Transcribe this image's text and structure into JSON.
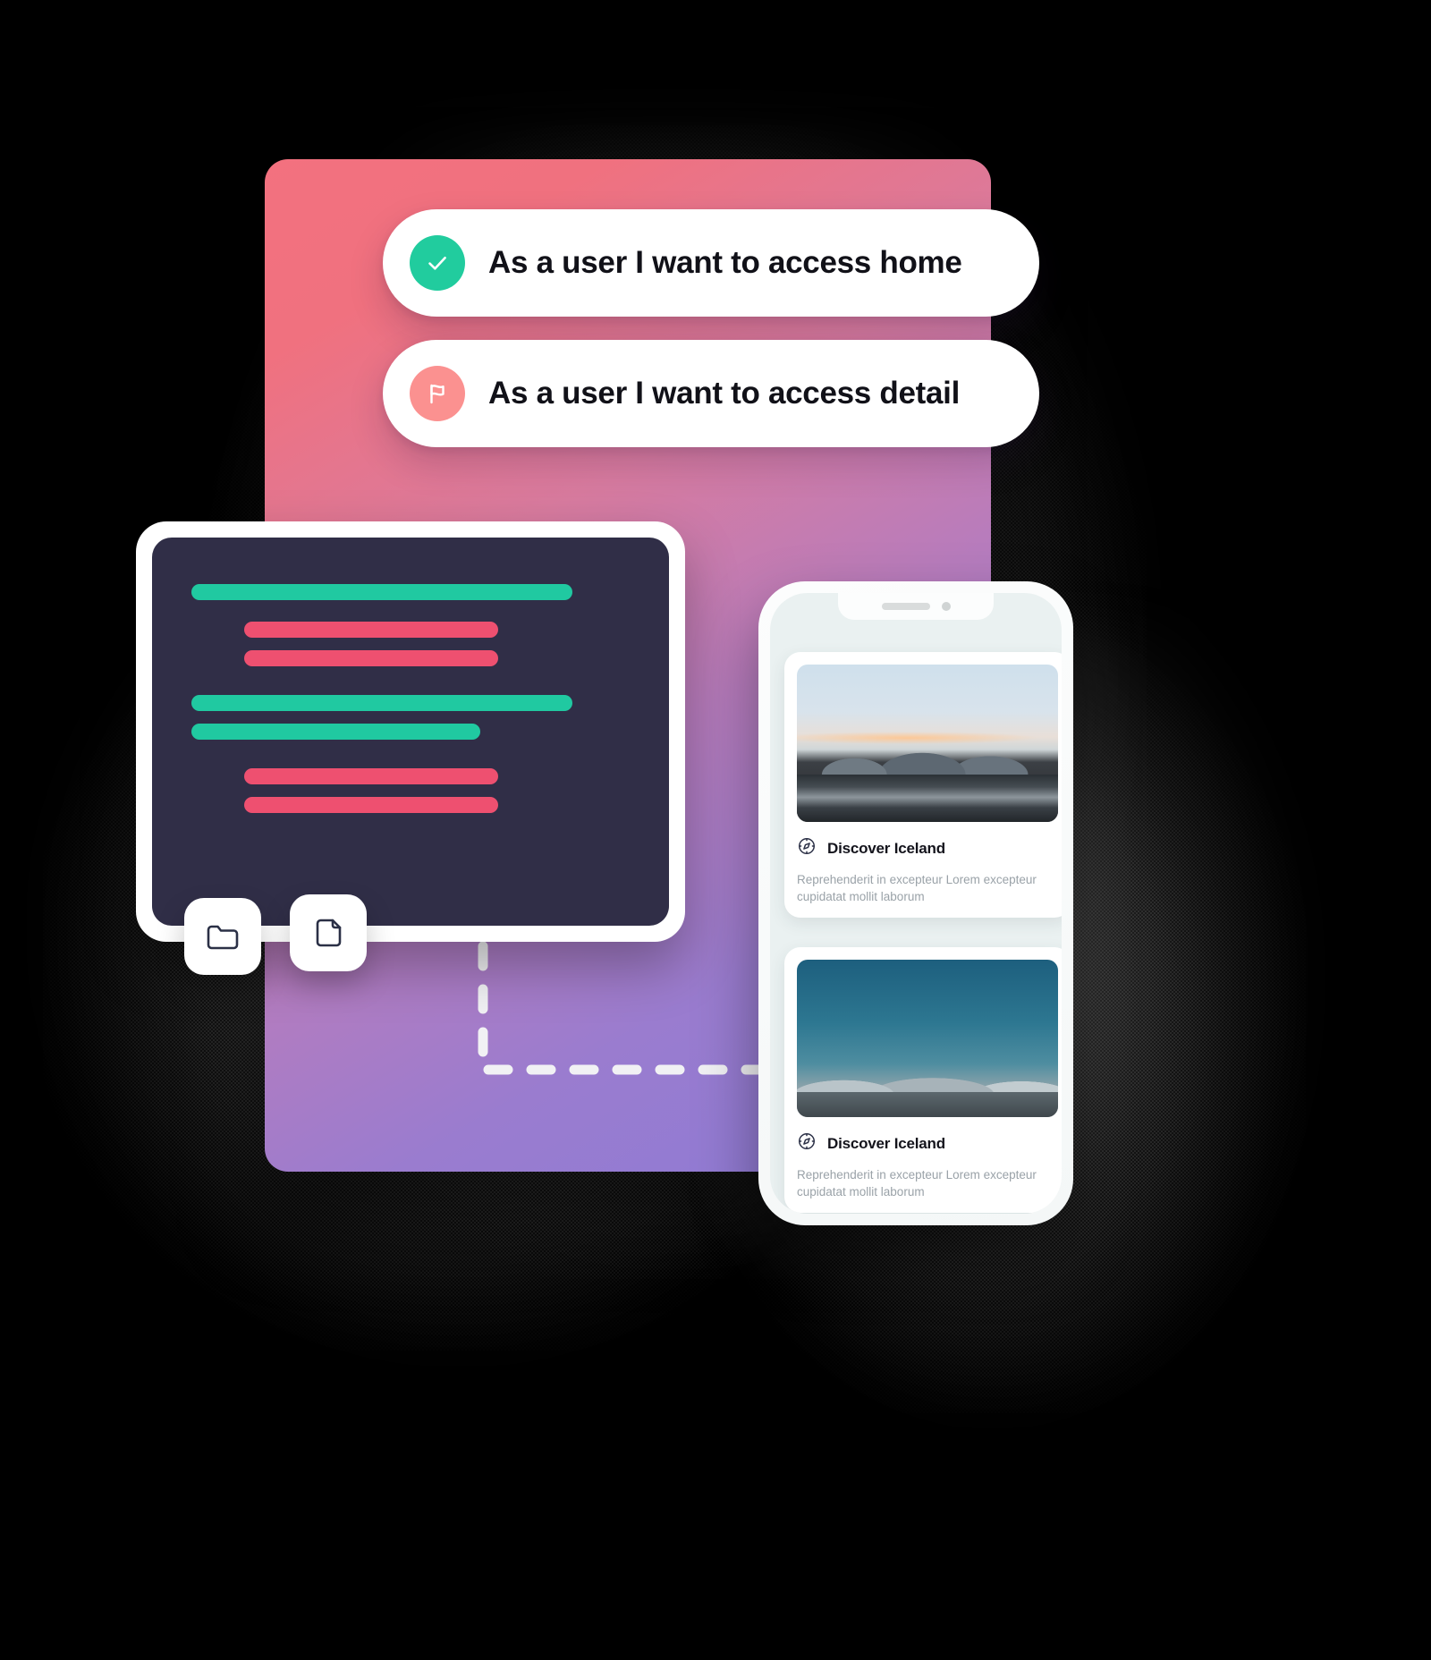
{
  "theme": {
    "background": "#000000",
    "gradient_start": "#F3717F",
    "gradient_mid": "#B77CBD",
    "gradient_end": "#8C7AD6",
    "accent_green": "#21CC9E",
    "accent_coral": "#FB9190",
    "code_bg": "#302E47",
    "code_bar_green": "#20C9A1",
    "code_bar_pink": "#EE5070",
    "icon_outline": "#2B3046"
  },
  "story_cards": [
    {
      "id": "story-home",
      "icon": "check-circle-icon",
      "icon_color": "#21CC9E",
      "text": "As a user I want to access home"
    },
    {
      "id": "story-detail",
      "icon": "flag-icon",
      "icon_color": "#FB9190",
      "text": "As a user I want to access detail"
    }
  ],
  "code_window": {
    "lines": [
      {
        "color": "green",
        "width_pct": 87
      },
      {
        "color": "pink",
        "width_pct": 58,
        "indent_pct": 12
      },
      {
        "color": "pink",
        "width_pct": 58,
        "indent_pct": 12
      },
      {
        "color": "green",
        "width_pct": 87
      },
      {
        "color": "green",
        "width_pct": 66
      },
      {
        "color": "pink",
        "width_pct": 58,
        "indent_pct": 12
      },
      {
        "color": "pink",
        "width_pct": 58,
        "indent_pct": 12
      }
    ]
  },
  "file_chips": [
    {
      "id": "chip-folder",
      "icon": "folder-icon"
    },
    {
      "id": "chip-file",
      "icon": "file-icon"
    }
  ],
  "phone": {
    "notch": {
      "speaker": "speaker-grille",
      "camera": "front-camera"
    },
    "cards": [
      {
        "id": "card-1",
        "photo_alt": "Iceland mountain range at dusk over black sand beach",
        "icon": "compass-icon",
        "title": "Discover Iceland",
        "body": "Reprehenderit in excepteur Lorem excepteur cupidatat mollit laborum"
      },
      {
        "id": "card-2",
        "photo_alt": "Iceland highland ridges under deep teal sky",
        "icon": "compass-icon",
        "title": "Discover Iceland",
        "body": "Reprehenderit in excepteur Lorem excepteur cupidatat mollit laborum"
      }
    ]
  },
  "connector": {
    "style": "dashed",
    "color": "#F1F1F4",
    "shape": "L-path from code window down and right to phone"
  }
}
